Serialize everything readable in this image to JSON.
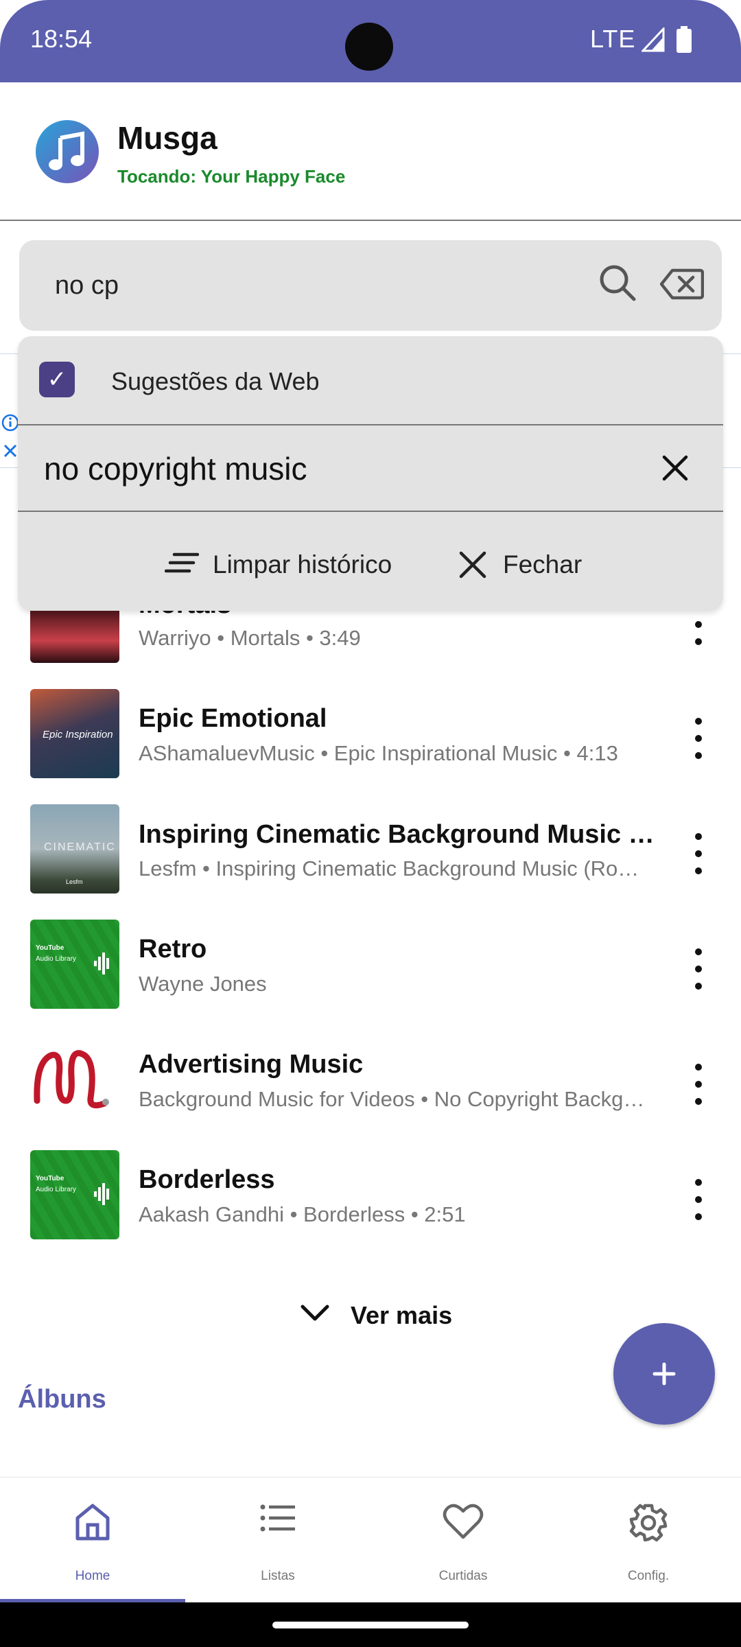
{
  "status": {
    "time": "18:54",
    "network": "LTE"
  },
  "header": {
    "app_name": "Musga",
    "now_playing": "Tocando: Your Happy Face"
  },
  "search": {
    "query": "no cp"
  },
  "dropdown": {
    "web_suggestions_label": "Sugestões da Web",
    "web_suggestions_checked": true,
    "suggestions": [
      "no copyright music"
    ],
    "clear_history_label": "Limpar histórico",
    "close_label": "Fechar"
  },
  "songs": [
    {
      "title": "Mortals",
      "meta": "Warriyo • Mortals • 3:49"
    },
    {
      "title": "Epic Emotional",
      "meta": "AShamaluevMusic • Epic Inspirational Music • 4:13"
    },
    {
      "title": "Inspiring Cinematic Background Music (…",
      "meta": "Lesfm • Inspiring Cinematic Background Music (Ro…"
    },
    {
      "title": "Retro",
      "meta": "Wayne Jones"
    },
    {
      "title": "Advertising Music",
      "meta": "Background Music for Videos • No Copyright Backg…"
    },
    {
      "title": "Borderless",
      "meta": "Aakash Gandhi • Borderless • 2:51"
    }
  ],
  "thumb_text": {
    "epic": "Epic Inspiration",
    "cinematic": "CINEMATIC",
    "lesfm": "Lesfm",
    "youtube": "YouTube",
    "audio_library": "Audio Library"
  },
  "see_more": "Ver mais",
  "albums_heading": "Álbuns",
  "fab_icon": "plus-icon",
  "nav": [
    {
      "label": "Home",
      "icon": "home-icon",
      "active": true
    },
    {
      "label": "Listas",
      "icon": "list-icon",
      "active": false
    },
    {
      "label": "Curtidas",
      "icon": "heart-icon",
      "active": false
    },
    {
      "label": "Config.",
      "icon": "gear-icon",
      "active": false
    }
  ],
  "colors": {
    "primary": "#5b5fae",
    "now_playing": "#1a8a2c",
    "secondary_text": "#777777",
    "search_bg": "#e3e3e3"
  }
}
